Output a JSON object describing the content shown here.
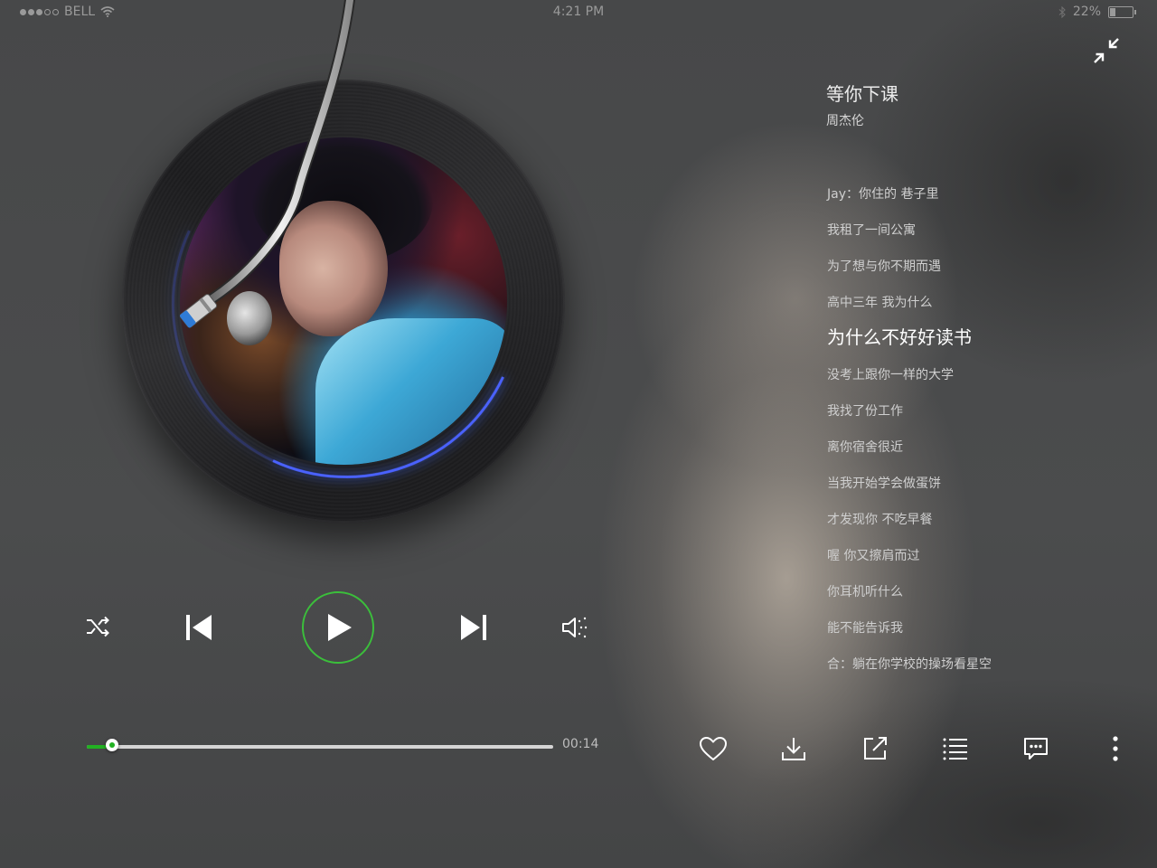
{
  "status_bar": {
    "carrier": "BELL",
    "time": "4:21 PM",
    "battery": "22%",
    "battery_level": 0.22
  },
  "player": {
    "song_title": "等你下课",
    "artist": "周杰伦",
    "elapsed": "00:14",
    "progress": 0.054,
    "accent_color": "#22b122",
    "glow_color": "#4a62ff"
  },
  "lyrics": [
    "Jay：你住的 巷子里",
    "我租了一间公寓",
    "为了想与你不期而遇",
    "高中三年 我为什么",
    "为什么不好好读书",
    "没考上跟你一样的大学",
    "我找了份工作",
    "离你宿舍很近",
    "当我开始学会做蛋饼",
    "才发现你 不吃早餐",
    "喔 你又擦肩而过",
    "你耳机听什么",
    "能不能告诉我",
    "合：躺在你学校的操场看星空"
  ],
  "current_lyric_index": 4,
  "controls": [
    "shuffle-icon",
    "previous-icon",
    "play-icon",
    "next-icon",
    "volume-icon"
  ],
  "actions": [
    "heart-icon",
    "download-icon",
    "share-icon",
    "playlist-icon",
    "comment-icon",
    "more-icon"
  ]
}
